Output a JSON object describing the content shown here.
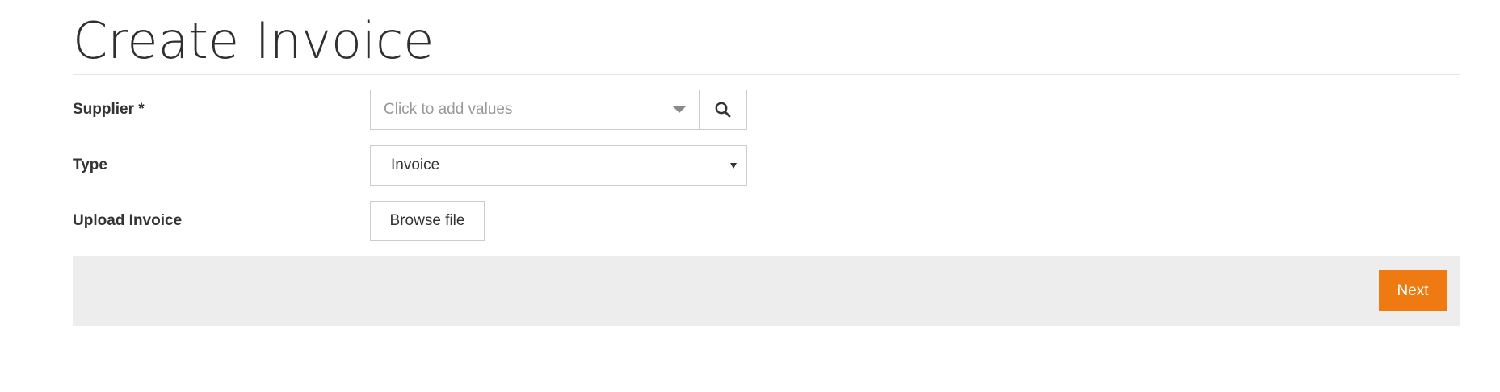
{
  "page": {
    "title": "Create Invoice"
  },
  "form": {
    "supplier": {
      "label": "Supplier *",
      "placeholder": "Click to add values",
      "search_icon": "search-icon",
      "dropdown_icon": "caret-down-icon"
    },
    "type": {
      "label": "Type",
      "value": "Invoice",
      "dropdown_icon": "caret-down-icon"
    },
    "upload": {
      "label": "Upload Invoice",
      "button_label": "Browse file"
    }
  },
  "footer": {
    "next_label": "Next"
  },
  "colors": {
    "accent": "#f07a12",
    "footer_bg": "#ededed",
    "border": "#cccccc"
  }
}
